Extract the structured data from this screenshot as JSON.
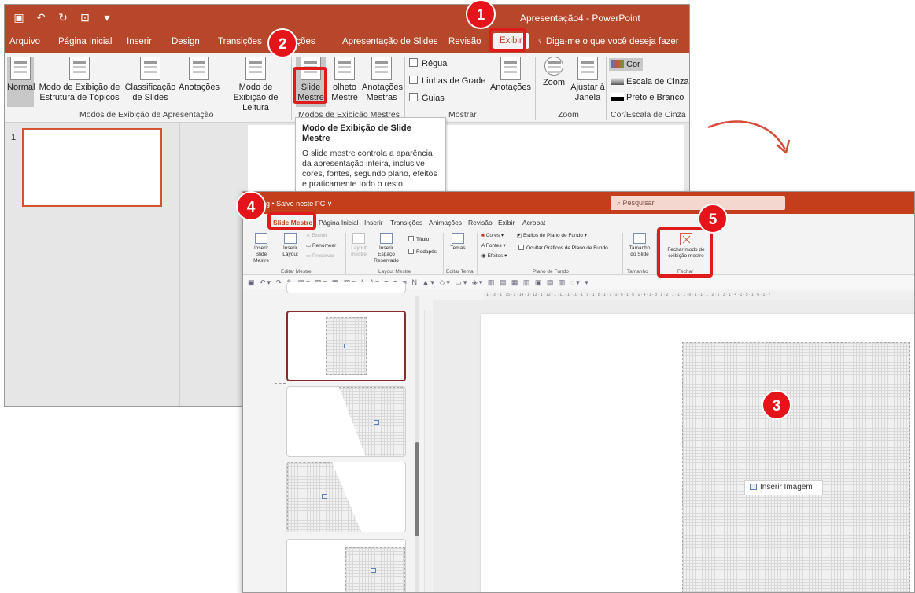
{
  "window1": {
    "app_title": "Apresentação4 - PowerPoint",
    "tabs": [
      "Arquivo",
      "Página Inicial",
      "Inserir",
      "Design",
      "Transições",
      "ações",
      "Apresentação de Slides",
      "Revisão",
      "Exibir"
    ],
    "tell_me": "Diga-me o que você deseja fazer",
    "ribbon": {
      "normal": "Normal",
      "estrutura": "Modo de Exibição de Estrutura de Tópicos",
      "classificacao": "Classificação de Slides",
      "anotacoes": "Anotações",
      "leitura": "Modo de Exibição de Leitura",
      "group_modos": "Modos de Exibição de Apresentação",
      "slide_mestre": "Slide Mestre",
      "folheto": "olheto Mestre",
      "anotacoes_mestras": "Anotações Mestras",
      "group_mestres": "Modos de Exibição Mestres",
      "regua": "Régua",
      "linhas_grade": "Linhas de Grade",
      "guias": "Guias",
      "anotacoes_mostrar": "Anotações",
      "group_mostrar": "Mostrar",
      "zoom": "Zoom",
      "ajustar": "Ajustar à Janela",
      "group_zoom": "Zoom",
      "cor": "Cor",
      "escala": "Escala de Cinza",
      "preto": "Preto e Branco",
      "group_cor": "Cor/Escala de Cinza"
    },
    "slide_number": "1",
    "tooltip": {
      "title": "Modo de Exibição de Slide Mestre",
      "body": "O slide mestre controla a aparência da apresentação inteira, inclusive cores, fontes, segundo plano, efeitos e praticamente todo o resto."
    }
  },
  "window2": {
    "filename": "arketing • Salvo neste PC ∨",
    "search": "Pesquisar",
    "tabs": [
      "Slide Mestre",
      "Página Inicial",
      "Inserir",
      "Transições",
      "Animações",
      "Revisão",
      "Exibir",
      "Acrobat"
    ],
    "ribbon": {
      "inserir_slide_mestre": "Inserir Slide Mestre",
      "inserir_layout": "Inserir Layout",
      "excluir": "Excluir",
      "renomear": "Renomear",
      "preservar": "Preservar",
      "group_editar": "Editar Mestre",
      "layout_mestre": "Layout mestre",
      "inserir_espaco": "Inserir Espaço Reservado",
      "titulo": "Título",
      "rodapes": "Rodapés",
      "group_layout": "Layout Mestre",
      "temas": "Temas",
      "group_tema": "Editar Tema",
      "cores": "Cores",
      "fontes": "Fontes",
      "efeitos": "Efeitos",
      "estilos_fundo": "Estilos de Plano de Fundo",
      "ocultar_graficos": "Ocultar Gráficos de Plano de Fundo",
      "group_fundo": "Plano de Fundo",
      "tamanho_slide": "Tamanho do Slide",
      "group_tamanho": "Tamanho",
      "fechar_modo": "Fechar modo de exibição mestre",
      "group_fechar": "Fechar"
    },
    "ruler_text": "· 1 · 16 · 1 · 15 · 1 · 14 · 1 · 13 · 1 · 12 · 1 · 11 · 1 · 10 · 1 · 9 · 1 · 8 · 1 · 7 · 1 · 6 · 1 · 5 · 1 · 4 · 1 · 3 · 1 · 2 · 1 · 1 · 1 · 0 · 1 · 1 · 1 · 2 · 1 · 3 · 1 · 4 · 1 · 5 · 1 · 6 · 1 · 7",
    "insert_image": "Inserir Imagem"
  },
  "callouts": [
    "1",
    "2",
    "3",
    "4",
    "5"
  ],
  "colors": {
    "ppt_orange": "#b7472a",
    "ppt_red": "#c43e1c",
    "callout_red": "#e5141a"
  }
}
